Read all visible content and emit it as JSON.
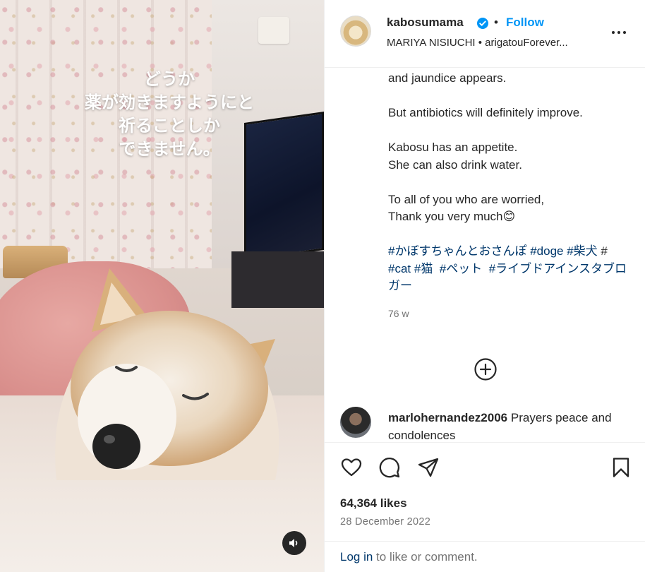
{
  "media": {
    "overlay_lines": [
      "どうか",
      "薬が効きますようにと",
      "祈ることしか",
      "できません。"
    ],
    "sound_icon": "speaker-icon"
  },
  "header": {
    "username": "kabosumama",
    "verified_icon": "verified-badge-icon",
    "separator": "•",
    "follow_label": "Follow",
    "subline": "MARIYA NISIUCHI • arigatouForever...",
    "more_icon": "more-options-icon"
  },
  "caption": {
    "paragraphs": [
      "and jaundice appears.",
      "But antibiotics will definitely improve.",
      "Kabosu has an appetite.\nShe can also drink water.",
      "To all of you who are worried,\nThank you very much😊"
    ],
    "hashtags": [
      "#かぼすちゃんとおさんぽ",
      "#doge",
      "#柴犬",
      "#",
      "#cat",
      "#猫",
      "#ペット",
      "#ライブドアインスタブロガー"
    ],
    "time_ago": "76 w"
  },
  "load_more_icon": "plus-circle-icon",
  "comment": {
    "username": "marlohernandez2006",
    "text": "Prayers peace and condolences"
  },
  "actions": {
    "like_icon": "heart-icon",
    "comment_icon": "comment-icon",
    "share_icon": "share-icon",
    "save_icon": "bookmark-icon"
  },
  "likes": "64,364 likes",
  "date": "28 December 2022",
  "footer": {
    "login_link": "Log in",
    "login_rest": " to like or comment."
  },
  "colors": {
    "link_blue": "#0095f6",
    "hashtag_blue": "#00376b",
    "text": "#262626",
    "muted": "#737373"
  }
}
